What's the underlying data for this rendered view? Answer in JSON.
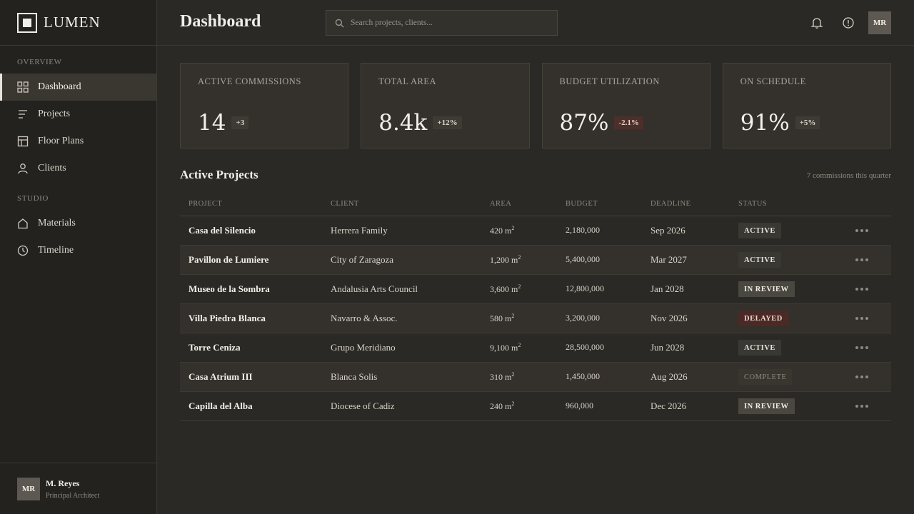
{
  "brand": {
    "name": "LUMEN"
  },
  "sidebar": {
    "overview_label": "OVERVIEW",
    "overview_items": [
      {
        "label": "Dashboard",
        "icon": "grid-icon"
      },
      {
        "label": "Projects",
        "icon": "list-icon"
      },
      {
        "label": "Floor Plans",
        "icon": "floor-plan-icon"
      },
      {
        "label": "Clients",
        "icon": "user-icon"
      }
    ],
    "studio_label": "STUDIO",
    "studio_items": [
      {
        "label": "Materials",
        "icon": "house-icon"
      },
      {
        "label": "Timeline",
        "icon": "clock-icon"
      }
    ]
  },
  "user": {
    "initials": "MR",
    "name": "M. Reyes",
    "role": "Principal Architect"
  },
  "header": {
    "title": "Dashboard",
    "search_placeholder": "Search projects, clients...",
    "avatar_initials": "MR"
  },
  "stats": [
    {
      "label": "ACTIVE COMMISSIONS",
      "value": "14",
      "delta": "+3"
    },
    {
      "label": "TOTAL AREA",
      "value": "8.4k",
      "delta": "+12%"
    },
    {
      "label": "BUDGET UTILIZATION",
      "value": "87%",
      "delta": "-2.1%"
    },
    {
      "label": "ON SCHEDULE",
      "value": "91%",
      "delta": "+5%"
    }
  ],
  "projects": {
    "title": "Active Projects",
    "meta": "7 commissions this quarter",
    "columns": [
      "PROJECT",
      "CLIENT",
      "AREA",
      "BUDGET",
      "DEADLINE",
      "STATUS"
    ],
    "rows": [
      {
        "project": "Casa del Silencio",
        "client": "Herrera Family",
        "area": "420 m",
        "budget": "2,180,000",
        "deadline": "Sep 2026",
        "status": "ACTIVE"
      },
      {
        "project": "Pavillon de Lumiere",
        "client": "City of Zaragoza",
        "area": "1,200 m",
        "budget": "5,400,000",
        "deadline": "Mar 2027",
        "status": "ACTIVE"
      },
      {
        "project": "Museo de la Sombra",
        "client": "Andalusia Arts Council",
        "area": "3,600 m",
        "budget": "12,800,000",
        "deadline": "Jan 2028",
        "status": "IN REVIEW"
      },
      {
        "project": "Villa Piedra Blanca",
        "client": "Navarro & Assoc.",
        "area": "580 m",
        "budget": "3,200,000",
        "deadline": "Nov 2026",
        "status": "DELAYED"
      },
      {
        "project": "Torre Ceniza",
        "client": "Grupo Meridiano",
        "area": "9,100 m",
        "budget": "28,500,000",
        "deadline": "Jun 2028",
        "status": "ACTIVE"
      },
      {
        "project": "Casa Atrium III",
        "client": "Blanca Solis",
        "area": "310 m",
        "budget": "1,450,000",
        "deadline": "Aug 2026",
        "status": "COMPLETE"
      },
      {
        "project": "Capilla del Alba",
        "client": "Diocese of Cadiz",
        "area": "240 m",
        "budget": "960,000",
        "deadline": "Dec 2026",
        "status": "IN REVIEW"
      }
    ],
    "area_unit_sup": "2"
  }
}
